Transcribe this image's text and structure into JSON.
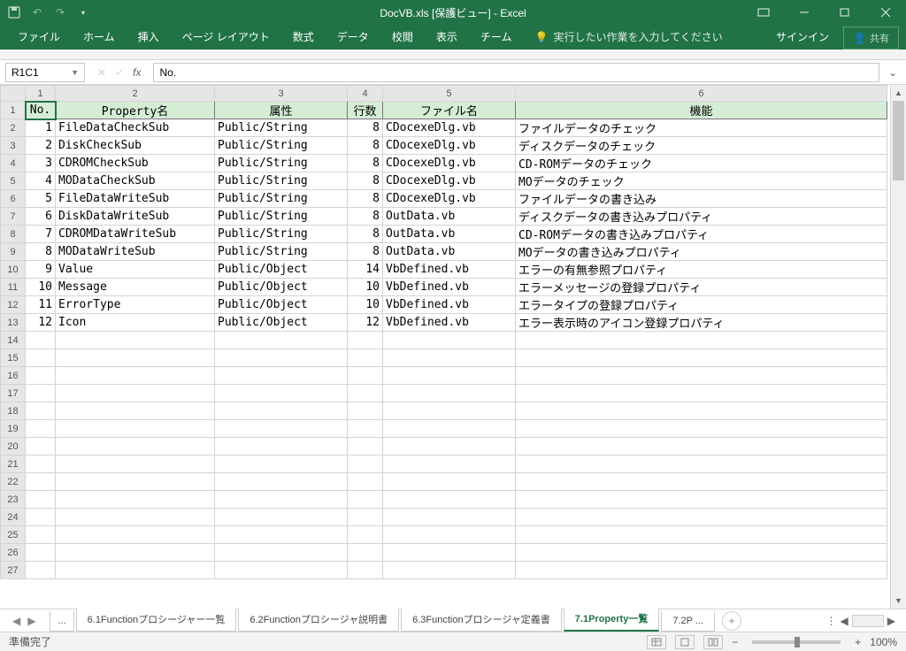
{
  "title": "DocVB.xls [保護ビュー] - Excel",
  "ribbon": {
    "tabs": [
      "ファイル",
      "ホーム",
      "挿入",
      "ページ レイアウト",
      "数式",
      "データ",
      "校閲",
      "表示",
      "チーム"
    ],
    "tell": "実行したい作業を入力してください",
    "signin": "サインイン",
    "share": "共有"
  },
  "namebox": "R1C1",
  "formula": "No.",
  "col_headers": [
    "1",
    "2",
    "3",
    "4",
    "5",
    "6"
  ],
  "headers": [
    "No.",
    "Property名",
    "属性",
    "行数",
    "ファイル名",
    "機能"
  ],
  "rows": [
    {
      "no": "1",
      "name": "FileDataCheckSub",
      "attr": "Public/String",
      "lines": "8",
      "file": "CDocexeDlg.vb",
      "func": "ファイルデータのチェック"
    },
    {
      "no": "2",
      "name": "DiskCheckSub",
      "attr": "Public/String",
      "lines": "8",
      "file": "CDocexeDlg.vb",
      "func": "ディスクデータのチェック"
    },
    {
      "no": "3",
      "name": "CDROMCheckSub",
      "attr": "Public/String",
      "lines": "8",
      "file": "CDocexeDlg.vb",
      "func": "CD-ROMデータのチェック"
    },
    {
      "no": "4",
      "name": "MODataCheckSub",
      "attr": "Public/String",
      "lines": "8",
      "file": "CDocexeDlg.vb",
      "func": "MOデータのチェック"
    },
    {
      "no": "5",
      "name": "FileDataWriteSub",
      "attr": "Public/String",
      "lines": "8",
      "file": "CDocexeDlg.vb",
      "func": "ファイルデータの書き込み"
    },
    {
      "no": "6",
      "name": "DiskDataWriteSub",
      "attr": "Public/String",
      "lines": "8",
      "file": "OutData.vb",
      "func": "ディスクデータの書き込みプロパティ"
    },
    {
      "no": "7",
      "name": "CDROMDataWriteSub",
      "attr": "Public/String",
      "lines": "8",
      "file": "OutData.vb",
      "func": "CD-ROMデータの書き込みプロパティ"
    },
    {
      "no": "8",
      "name": "MODataWriteSub",
      "attr": "Public/String",
      "lines": "8",
      "file": "OutData.vb",
      "func": "MOデータの書き込みプロパティ"
    },
    {
      "no": "9",
      "name": "Value",
      "attr": "Public/Object",
      "lines": "14",
      "file": "VbDefined.vb",
      "func": "エラーの有無参照プロパティ"
    },
    {
      "no": "10",
      "name": "Message",
      "attr": "Public/Object",
      "lines": "10",
      "file": "VbDefined.vb",
      "func": "エラーメッセージの登録プロパティ"
    },
    {
      "no": "11",
      "name": "ErrorType",
      "attr": "Public/Object",
      "lines": "10",
      "file": "VbDefined.vb",
      "func": "エラータイプの登録プロパティ"
    },
    {
      "no": "12",
      "name": "Icon",
      "attr": "Public/Object",
      "lines": "12",
      "file": "VbDefined.vb",
      "func": "エラー表示時のアイコン登録プロパティ"
    }
  ],
  "empty_rows": 14,
  "sheet_tabs": {
    "more": "...",
    "items": [
      "6.1Functionプロシージャー一覧",
      "6.2Functionプロシージャ説明書",
      "6.3Functionプロシージャ定義書",
      "7.1Property一覧",
      "7.2P ..."
    ],
    "active": 3
  },
  "status": {
    "ready": "準備完了",
    "zoom": "100%"
  }
}
